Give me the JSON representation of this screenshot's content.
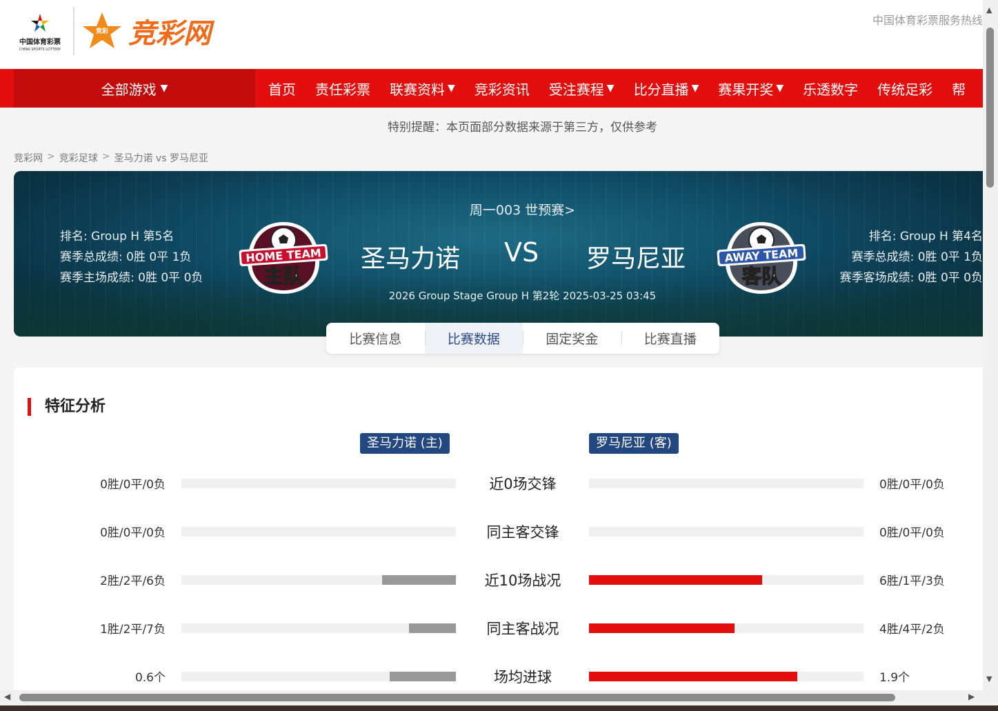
{
  "header": {
    "logo_cslc_cn": "中国体育彩票",
    "logo_cslc_en": "CHINA SPORTS LOTTERY",
    "logo_brand": "竞彩网",
    "logo_star_text": "竞彩",
    "hotline": "中国体育彩票服务热线"
  },
  "nav": {
    "all_games": "全部游戏",
    "items": [
      {
        "label": "首页"
      },
      {
        "label": "责任彩票"
      },
      {
        "label": "联赛资料"
      },
      {
        "label": "竞彩资讯"
      },
      {
        "label": "受注赛程"
      },
      {
        "label": "比分直播"
      },
      {
        "label": "赛果开奖"
      },
      {
        "label": "乐透数字"
      },
      {
        "label": "传统足彩"
      },
      {
        "label": "帮"
      }
    ]
  },
  "notice": "特别提醒：本页面部分数据来源于第三方，仅供参考",
  "breadcrumb": [
    "竞彩网",
    "竞彩足球",
    "圣马力诺 vs 罗马尼亚"
  ],
  "match": {
    "round": "周一003 世预赛>",
    "home_team": "圣马力诺",
    "away_team": "罗马尼亚",
    "vs": "VS",
    "sub": "2026 Group Stage Group H 第2轮 2025-03-25 03:45",
    "home_badge_en": "HOME TEAM",
    "home_badge_cn": "主队",
    "away_badge_en": "AWAY TEAM",
    "away_badge_cn": "客队",
    "home_stats": [
      "排名: Group H 第5名",
      "赛季总成绩: 0胜 0平 1负",
      "赛季主场成绩: 0胜 0平 0负"
    ],
    "away_stats": [
      "排名: Group H 第4名",
      "赛季总成绩: 0胜 0平 1负",
      "赛季客场成绩: 0胜 0平 0负"
    ]
  },
  "tabs": [
    {
      "label": "比赛信息",
      "active": false
    },
    {
      "label": "比赛数据",
      "active": true
    },
    {
      "label": "固定奖金",
      "active": false
    },
    {
      "label": "比赛直播",
      "active": false
    }
  ],
  "analysis": {
    "title": "特征分析",
    "home_tag": "圣马力诺 (主)",
    "away_tag": "罗马尼亚 (客)",
    "rows": [
      {
        "label": "近0场交锋",
        "home": "0胜/0平/0负",
        "away": "0胜/0平/0负",
        "home_fill": 0,
        "away_fill": 0
      },
      {
        "label": "同主客交锋",
        "home": "0胜/0平/0负",
        "away": "0胜/0平/0负",
        "home_fill": 0,
        "away_fill": 0
      },
      {
        "label": "近10场战况",
        "home": "2胜/2平/6负",
        "away": "6胜/1平/3负",
        "home_fill": 0.27,
        "away_fill": 0.63
      },
      {
        "label": "同主客战况",
        "home": "1胜/2平/7负",
        "away": "4胜/4平/2负",
        "home_fill": 0.17,
        "away_fill": 0.53
      },
      {
        "label": "场均进球",
        "home": "0.6个",
        "away": "1.9个",
        "home_fill": 0.24,
        "away_fill": 0.76
      }
    ]
  },
  "colors": {
    "brand_red": "#e30e0e",
    "nav_dark_red": "#c40b0b",
    "team_tag_blue": "#23477f",
    "home_bar": "#999999",
    "away_bar": "#e30e0e"
  }
}
